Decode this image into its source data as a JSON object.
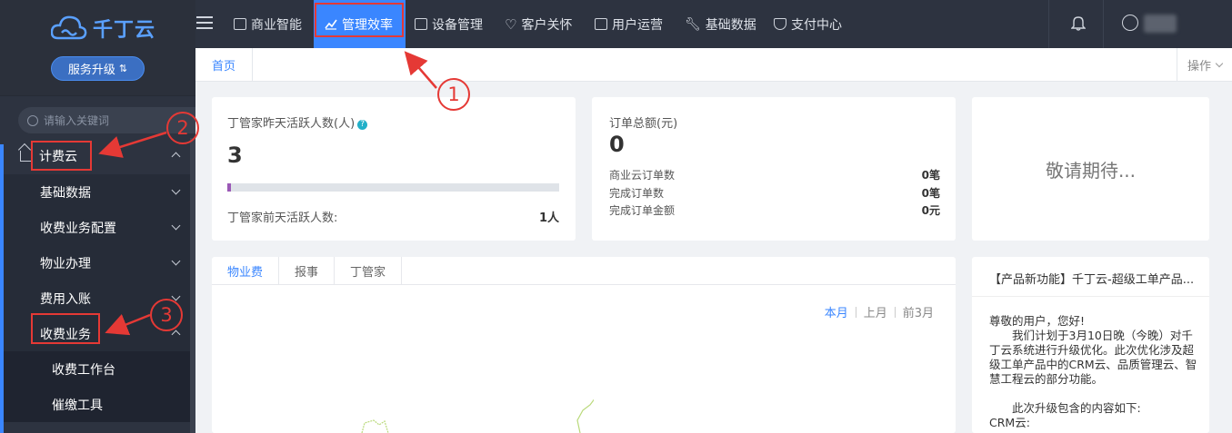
{
  "sidebar": {
    "logo_text": "千丁云",
    "upgrade_label": "服务升级",
    "search_placeholder": "请输入关键词",
    "menu": [
      {
        "label": "计费云",
        "level": 0,
        "expanded": true
      },
      {
        "label": "基础数据",
        "level": 1
      },
      {
        "label": "收费业务配置",
        "level": 1
      },
      {
        "label": "物业办理",
        "level": 1
      },
      {
        "label": "费用入账",
        "level": 1
      },
      {
        "label": "收费业务",
        "level": 1,
        "expanded": true
      },
      {
        "label": "收费工作台",
        "level": 2
      },
      {
        "label": "催缴工具",
        "level": 2
      }
    ]
  },
  "topnav": {
    "items": [
      {
        "label": "商业智能",
        "icon": "chart-building-icon"
      },
      {
        "label": "管理效率",
        "icon": "trend-icon",
        "active": true
      },
      {
        "label": "设备管理",
        "icon": "device-icon"
      },
      {
        "label": "客户关怀",
        "icon": "heart-icon"
      },
      {
        "label": "用户运营",
        "icon": "user-card-icon"
      },
      {
        "label": "基础数据",
        "icon": "wrench-icon"
      },
      {
        "label": "支付中心",
        "icon": "shield-pay-icon"
      }
    ]
  },
  "breadcrumb": {
    "home": "首页",
    "ops": "操作"
  },
  "card_active": {
    "title": "丁管家昨天活跃人数(人)",
    "value": "3",
    "progress": 0.01,
    "prev_label": "丁管家前天活跃人数:",
    "prev_value": "1人"
  },
  "card_orders": {
    "title": "订单总额(元)",
    "value": "0",
    "rows": [
      {
        "label": "商业云订单数",
        "value": "0笔"
      },
      {
        "label": "完成订单数",
        "value": "0笔"
      },
      {
        "label": "完成订单金额",
        "value": "0元"
      }
    ]
  },
  "card_coming": {
    "text": "敬请期待..."
  },
  "chart_card": {
    "tabs": [
      "物业费",
      "报事",
      "丁管家"
    ],
    "active_tab": "物业费",
    "periods": [
      "本月",
      "上月",
      "前3月"
    ],
    "active_period": "本月"
  },
  "news": {
    "title": "【产品新功能】千丁云-超级工单产品...",
    "greeting": "尊敬的用户，您好!",
    "line1": "我们计划于3月10日晚（今晚）对千丁云系统进行升级优化。此次优化涉及超级工单产品中的CRM云、品质管理云、智慧工程云的部分功能。",
    "line2": "此次升级包含的内容如下:",
    "line3": "CRM云:"
  },
  "annotations": [
    "1",
    "2",
    "3"
  ],
  "colors": {
    "accent": "#3a86ff",
    "annotation": "#e53935",
    "nav_bg": "#2d3340"
  }
}
